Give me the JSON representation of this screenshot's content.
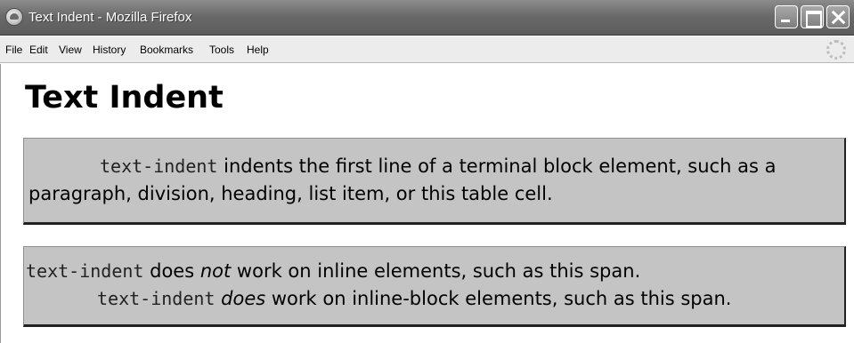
{
  "window": {
    "title": "Text Indent - Mozilla Firefox",
    "icon": "firefox-icon",
    "controls": [
      "minimize-icon",
      "maximize-icon",
      "close-icon"
    ]
  },
  "menubar": {
    "items": [
      {
        "label": "File"
      },
      {
        "label": "Edit"
      },
      {
        "label": "View"
      },
      {
        "label": "History"
      },
      {
        "label": "Bookmarks"
      },
      {
        "label": "Tools"
      },
      {
        "label": "Help"
      }
    ],
    "throbber": "loading-throbber-icon"
  },
  "page": {
    "heading": "Text Indent",
    "box1": {
      "code": "text-indent",
      "text": " indents the first line of a terminal block element, such as a paragraph, division, heading, list item, or this table cell."
    },
    "box2": {
      "line1_code": "text-indent",
      "line1_pre": " does ",
      "line1_em": "not",
      "line1_post": " work on inline elements, such as this span.",
      "line2_code": "text-indent",
      "line2_em": "does",
      "line2_post": " work on inline-block elements, such as this span."
    }
  }
}
